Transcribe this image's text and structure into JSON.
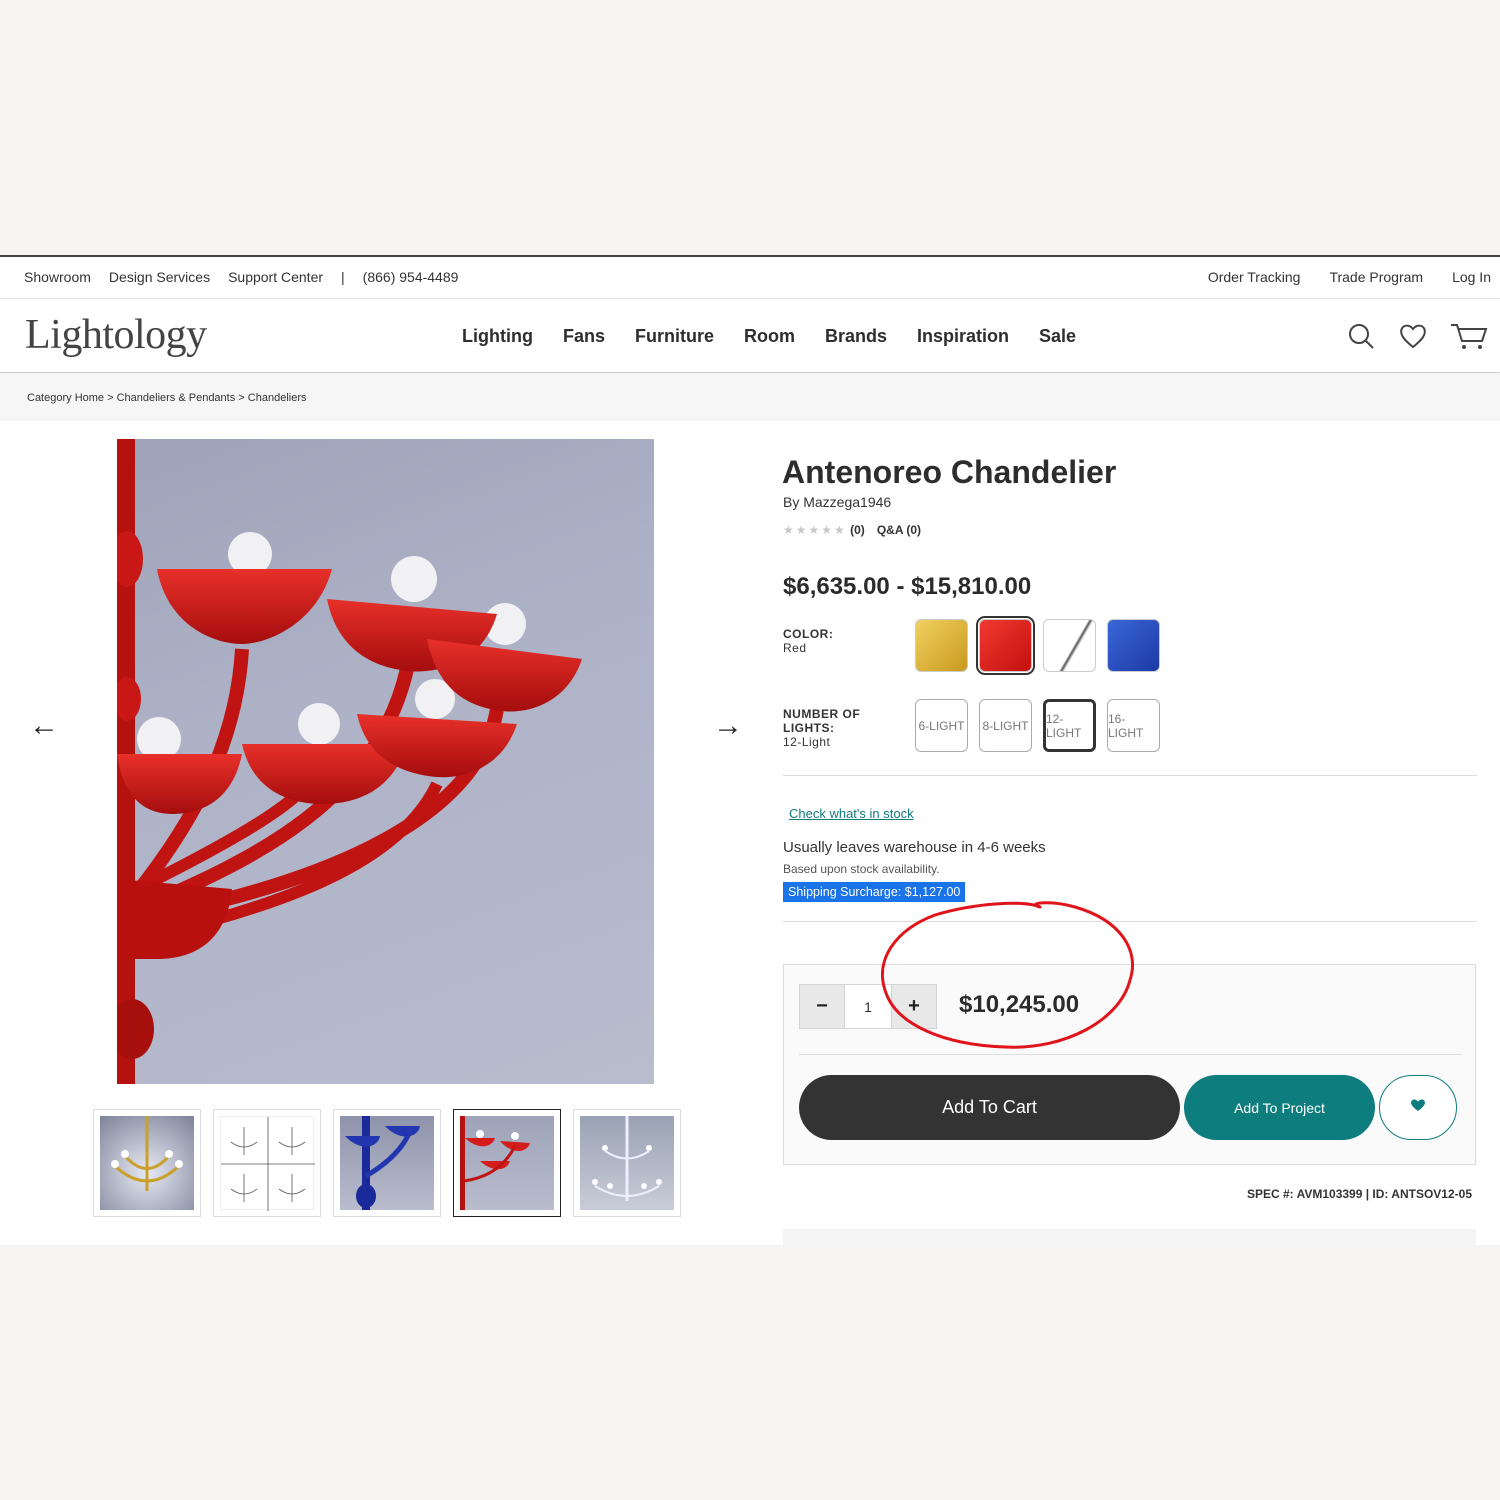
{
  "util_bar": {
    "left_links": [
      "Showroom",
      "Design Services",
      "Support Center"
    ],
    "separator": "|",
    "phone": "(866) 954-4489",
    "right_links": [
      "Order Tracking",
      "Trade Program",
      "Log In"
    ]
  },
  "header": {
    "logo": "Lightology",
    "nav": [
      "Lighting",
      "Fans",
      "Furniture",
      "Room",
      "Brands",
      "Inspiration",
      "Sale"
    ],
    "icons": [
      "search-icon",
      "heart-icon",
      "cart-icon"
    ]
  },
  "breadcrumb": [
    "Category Home",
    "Chandeliers & Pendants",
    "Chandeliers"
  ],
  "breadcrumb_sep": " > ",
  "product": {
    "title": "Antenoreo Chandelier",
    "byline": "By Mazzega1946",
    "stars_glyph": "★★★★★",
    "review_count": "(0)",
    "qa": "Q&A (0)",
    "price_range": "$6,635.00 - $15,810.00",
    "color_label": "COLOR:",
    "color_value": "Red",
    "colors": [
      {
        "name": "Gold",
        "hex": "#d9b23a"
      },
      {
        "name": "Red",
        "hex": "#e0201e",
        "selected": true
      },
      {
        "name": "Crystal",
        "hex": "#eef0f4"
      },
      {
        "name": "Blue",
        "hex": "#2446b6"
      }
    ],
    "lights_label": "NUMBER OF LIGHTS:",
    "lights_value": "12-Light",
    "lights_options": [
      "6-LIGHT",
      "8-LIGHT",
      "12-LIGHT",
      "16-LIGHT"
    ],
    "lights_selected": "12-LIGHT",
    "stock_link": "Check what's in stock",
    "leaves": "Usually leaves warehouse in 4-6 weeks",
    "based": "Based upon stock availability.",
    "surcharge": "Shipping Surcharge: $1,127.00",
    "quantity": "1",
    "minus": "−",
    "plus": "+",
    "total": "$10,245.00",
    "add_to_cart": "Add To Cart",
    "add_to_project": "Add To Project",
    "spec": "SPEC #: AVM103399 | ID: ANTSOV12-05"
  },
  "gallery": {
    "prev": "←",
    "next": "→",
    "thumbs": [
      "gold-chandelier",
      "line-drawings",
      "blue-chandelier",
      "red-chandelier",
      "crystal-chandelier"
    ],
    "active_thumb": 3
  },
  "colors": {
    "accent": "#0d7d7d",
    "cart_button": "#333333",
    "highlight": "#1a73e8",
    "annotation": "#e0141b"
  }
}
